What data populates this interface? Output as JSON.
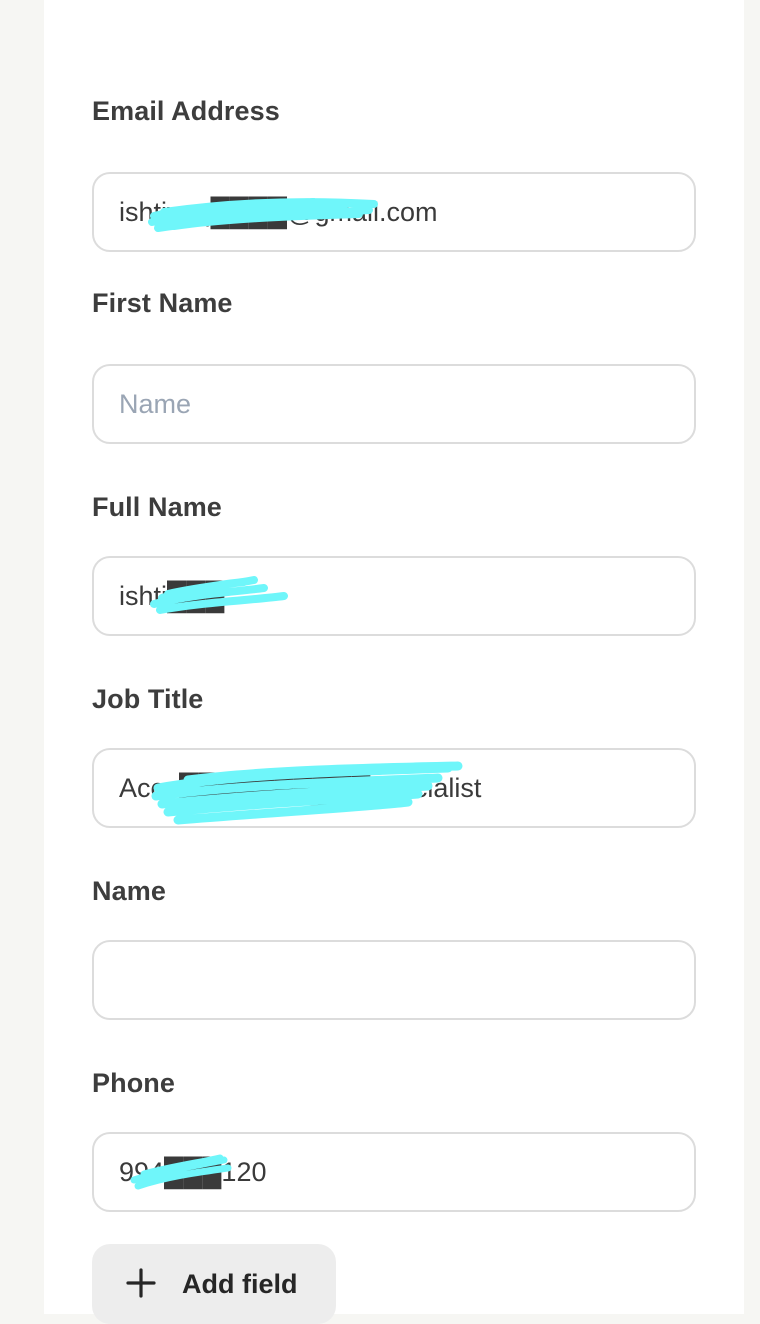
{
  "form": {
    "fields": [
      {
        "label": "Email Address",
        "value": "ishtiyaq████@gmail.com",
        "placeholder": "",
        "redacted": true
      },
      {
        "label": "First Name",
        "value": "",
        "placeholder": "Name",
        "redacted": false
      },
      {
        "label": "Full Name",
        "value": "ishti███",
        "placeholder": "",
        "redacted": true
      },
      {
        "label": "Job Title",
        "value": "Acco██████████specialist",
        "placeholder": "",
        "redacted": true
      },
      {
        "label": "Name",
        "value": "",
        "placeholder": "",
        "redacted": false
      },
      {
        "label": "Phone",
        "value": "994███120",
        "placeholder": "",
        "redacted": true
      }
    ],
    "add_field_label": "Add field"
  },
  "icons": {
    "add": "plus-icon"
  },
  "colors": {
    "page_background": "#f6f6f3",
    "card_background": "#ffffff",
    "label_text": "#3d3d3d",
    "input_border": "#dcdcdc",
    "placeholder_text": "#9aa5b4",
    "redaction_scribble": "#6ff6fa",
    "button_background": "#ededed"
  }
}
